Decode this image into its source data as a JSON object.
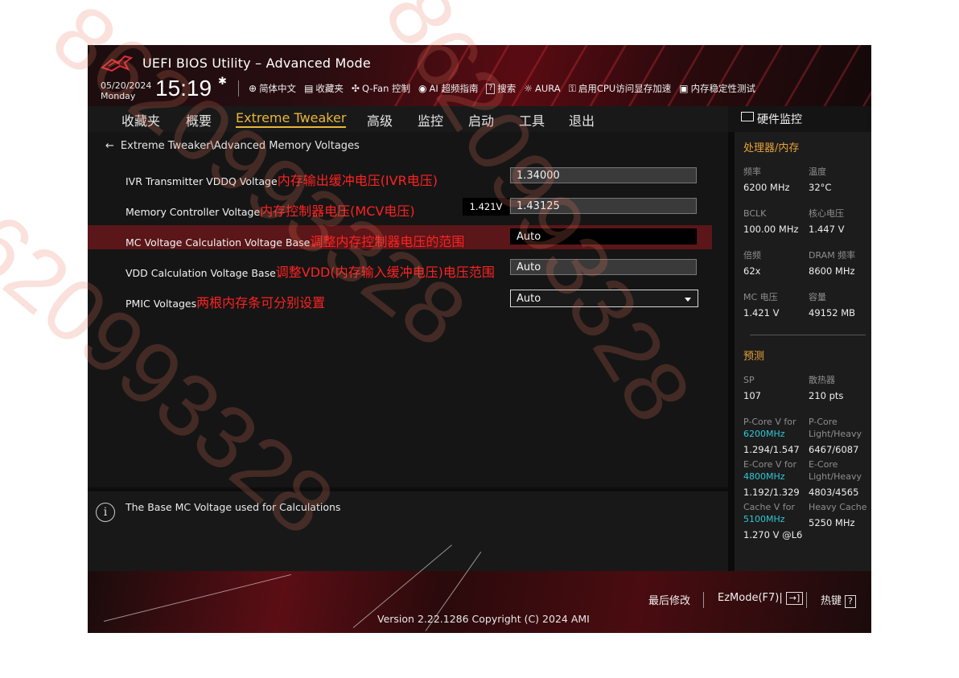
{
  "header": {
    "app_title": "UEFI BIOS Utility – Advanced Mode",
    "date": "05/20/2024",
    "weekday": "Monday",
    "time": "15:19",
    "toolbar": [
      {
        "icon": "globe-icon",
        "label": "简体中文"
      },
      {
        "icon": "favorites-icon",
        "label": "收藏夹"
      },
      {
        "icon": "fan-icon",
        "label": "Q-Fan 控制"
      },
      {
        "icon": "ai-icon",
        "label": "AI 超频指南"
      },
      {
        "icon": "help-box-icon",
        "label": "搜索",
        "box": "?"
      },
      {
        "icon": "aura-icon",
        "label": "AURA"
      },
      {
        "icon": "cpu-memory-icon",
        "label": "启用CPU访问显存加速"
      },
      {
        "icon": "memory-test-icon",
        "label": "内存稳定性测试"
      }
    ]
  },
  "nav": {
    "tabs": [
      "收藏夹",
      "概要",
      "Extreme Tweaker",
      "高级",
      "监控",
      "启动",
      "工具",
      "退出"
    ],
    "active": "Extreme Tweaker"
  },
  "main": {
    "breadcrumb": "Extreme Tweaker\\Advanced Memory Voltages",
    "rows": [
      {
        "label": "IVR Transmitter VDDQ Voltage",
        "note": "内存输出缓冲电压(IVR电压)",
        "value": "1.34000",
        "readout": ""
      },
      {
        "label": "Memory Controller Voltage",
        "note": "内存控制器电压(MCV电压)",
        "value": "1.43125",
        "readout": "1.421V"
      },
      {
        "label": "MC Voltage Calculation Voltage Base",
        "note": "调整内存控制器电压的范围",
        "value": "Auto",
        "readout": ""
      },
      {
        "label": "VDD Calculation Voltage Base",
        "note": "调整VDD(内存输入缓冲电压)电压范围",
        "value": "Auto",
        "readout": ""
      },
      {
        "label": "PMIC Voltages",
        "note": "两根内存条可分别设置",
        "value": "Auto",
        "readout": ""
      }
    ],
    "selected_row": "MC Voltage Calculation Voltage Base"
  },
  "help": {
    "text": "The Base MC Voltage used for Calculations"
  },
  "hardware_monitor": {
    "title": "硬件监控",
    "cpu_section": "处理器/内存",
    "cpu_items": [
      {
        "label": "频率",
        "value": "6200 MHz"
      },
      {
        "label": "温度",
        "value": "32°C"
      },
      {
        "label": "BCLK",
        "value": "100.00 MHz"
      },
      {
        "label": "核心电压",
        "value": "1.447 V"
      },
      {
        "label": "倍频",
        "value": "62x"
      },
      {
        "label": "DRAM 频率",
        "value": "8600 MHz"
      },
      {
        "label": "MC 电压",
        "value": "1.421 V"
      },
      {
        "label": "容量",
        "value": "49152 MB"
      }
    ],
    "predict_section": "预测",
    "predict_items": [
      {
        "label": "SP",
        "value": "107"
      },
      {
        "label": "散热器",
        "value": "210 pts"
      },
      {
        "label": "P-Core V for",
        "label2": "6200MHz",
        "value": "1.294/1.547"
      },
      {
        "label": "P-Core",
        "label2": "Light/Heavy",
        "value": "6467/6087"
      },
      {
        "label": "E-Core V for",
        "label2": "4800MHz",
        "value": "1.192/1.329"
      },
      {
        "label": "E-Core",
        "label2": "Light/Heavy",
        "value": "4803/4565"
      },
      {
        "label": "Cache V for",
        "label2": "5100MHz",
        "value": "1.270 V @L6"
      },
      {
        "label": "Heavy Cache",
        "label2": "",
        "value": "5250 MHz"
      }
    ]
  },
  "footer": {
    "last_modified": "最后修改",
    "ezmode": "EzMode(F7)|",
    "hotkeys": "热键",
    "hotkeys_box": "?",
    "version": "Version 2.22.1286 Copyright (C) 2024 AMI"
  },
  "watermark": "8620993328",
  "colors": {
    "accent": "#e8b63a",
    "section": "#e8a43a",
    "highlight_row": "#5a1618",
    "note_red": "#ff2222",
    "cyan": "#2ec8d8"
  }
}
